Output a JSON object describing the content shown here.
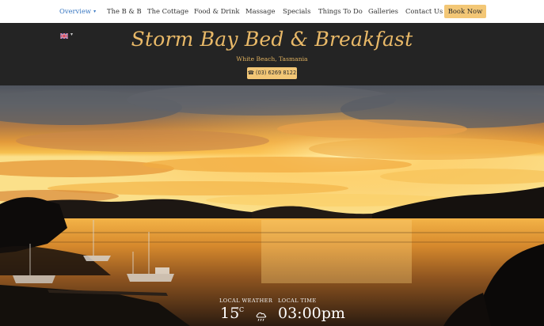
{
  "nav": {
    "items": [
      {
        "label": "Overview",
        "active": true
      },
      {
        "label": "The B & B",
        "active": false
      },
      {
        "label": "The Cottage",
        "active": false
      },
      {
        "label": "Food & Drink",
        "active": false
      },
      {
        "label": "Massage",
        "active": false
      },
      {
        "label": "Specials",
        "active": false
      },
      {
        "label": "Things To Do",
        "active": false
      },
      {
        "label": "Galleries",
        "active": false
      },
      {
        "label": "Contact Us",
        "active": false
      }
    ],
    "overview_caret": "▾",
    "book_now_label": "Book Now"
  },
  "header": {
    "language_flag_icon": "uk-flag-icon",
    "language_caret": "▾",
    "title": "Storm Bay Bed & Breakfast",
    "subtitle": "White Beach, Tasmania",
    "phone_icon": "☎",
    "phone_label": "(03) 6269 8122"
  },
  "widget": {
    "weather_label": "LOCAL WEATHER",
    "temperature": "15",
    "temperature_unit": "°C",
    "weather_icon": "cloud-rain-icon",
    "time_label": "LOCAL TIME",
    "time": "03:00pm"
  },
  "colors": {
    "accent_gold": "#e9b968",
    "button_gold": "#f3c776",
    "nav_active": "#3a78c2",
    "header_bg": "#242424"
  }
}
